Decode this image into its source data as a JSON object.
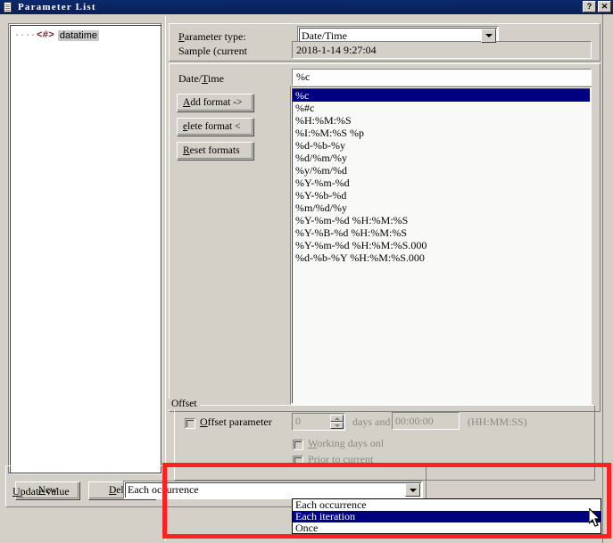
{
  "window": {
    "title": "Parameter List",
    "icon": "parameter-list-icon",
    "help_button": "?",
    "close_button": "✕"
  },
  "tree": {
    "items": [
      {
        "dots": "····",
        "icon": "<#>",
        "label": "datatime",
        "selected": true
      }
    ]
  },
  "footer_buttons": {
    "new": {
      "label": "New",
      "accesskey": "N"
    },
    "delete": {
      "label": "Delete",
      "accesskey": "D"
    }
  },
  "parameter_type": {
    "label": "Parameter type:",
    "accesskey": "P",
    "value": "Date/Time",
    "options": [
      "Date/Time"
    ]
  },
  "sample": {
    "label": "Sample (current",
    "value": "2018-1-14 9:27:04"
  },
  "datetime_field": {
    "label": "Date/Time",
    "accesskey": "T",
    "value": "%c"
  },
  "format_buttons": {
    "add": {
      "label": "Add format ->",
      "accesskey": "A"
    },
    "delete": {
      "label": "elete format <",
      "accesskey": "e"
    },
    "reset": {
      "label": "Reset formats",
      "accesskey": "R"
    }
  },
  "format_list": {
    "selected_index": 0,
    "items": [
      "%c",
      "%#c",
      "%H:%M:%S",
      "%I:%M:%S %p",
      "%d-%b-%y",
      "%d/%m/%y",
      "%y/%m/%d",
      "%Y-%m-%d",
      "%Y-%b-%d",
      "%m/%d/%y",
      "%Y-%m-%d %H:%M:%S",
      "%Y-%B-%d %H:%M:%S",
      "%Y-%m-%d %H:%M:%S.000",
      "%d-%b-%Y %H:%M:%S.000"
    ]
  },
  "offset": {
    "group_label": "Offset",
    "checkbox_label": "Offset parameter",
    "checkbox_accesskey": "O",
    "checkbox_checked": false,
    "days_value": "0",
    "days_and_label": "days and",
    "time_value": "00:00:00",
    "time_hint": "(HH:MM:SS)",
    "working_days_label": "Working days onl",
    "working_days_accesskey": "W",
    "working_days_checked": false,
    "prior_label": "Prior to current",
    "prior_accesskey": "P",
    "prior_checked": false
  },
  "update_value": {
    "label": "Update value",
    "accesskey": "U",
    "value": "Each occurrence",
    "dropdown_open": true,
    "options": [
      {
        "label": "Each occurrence",
        "selected": false
      },
      {
        "label": "Each iteration",
        "selected": true
      },
      {
        "label": "Once",
        "selected": false
      }
    ]
  },
  "annotation": {
    "type": "red-rectangle-highlight",
    "color": "#ff2020"
  },
  "colors": {
    "titlebar": "#0a2461",
    "face": "#d4d0c8",
    "selection": "#000080",
    "highlight": "#ff2020"
  }
}
